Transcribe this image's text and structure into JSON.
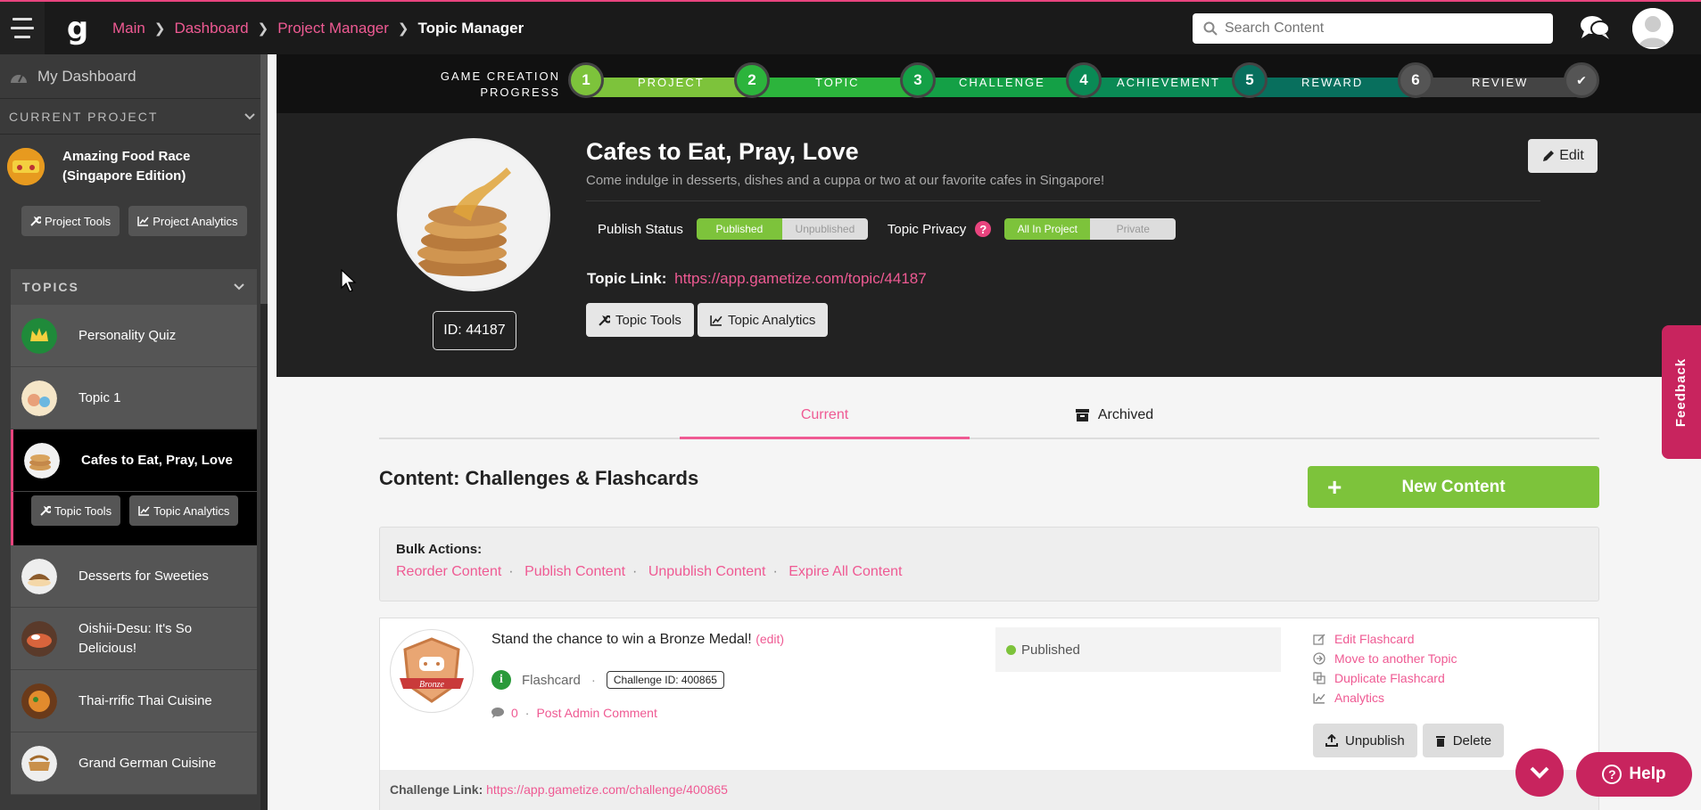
{
  "topbar": {
    "logo": "g",
    "breadcrumbs": [
      {
        "label": "Main"
      },
      {
        "label": "Dashboard"
      },
      {
        "label": "Project Manager"
      }
    ],
    "current": "Topic Manager",
    "search_placeholder": "Search Content"
  },
  "sidebar": {
    "my_dashboard": "My Dashboard",
    "current_project_header": "CURRENT PROJECT",
    "project_name": "Amazing Food Race (Singapore Edition)",
    "project_tools": "Project Tools",
    "project_analytics": "Project Analytics",
    "topics_header": "TOPICS",
    "topics": [
      {
        "label": "Personality Quiz"
      },
      {
        "label": "Topic 1"
      },
      {
        "label": "Cafes to Eat, Pray, Love"
      },
      {
        "label": "Desserts for Sweeties"
      },
      {
        "label": "Oishii-Desu: It's So Delicious!"
      },
      {
        "label": "Thai-rrific Thai Cuisine"
      },
      {
        "label": "Grand German Cuisine"
      }
    ],
    "topic_tools": "Topic Tools",
    "topic_analytics": "Topic Analytics"
  },
  "progress": {
    "label_line1": "GAME CREATION",
    "label_line2": "PROGRESS",
    "steps": [
      {
        "num": "1",
        "label": "PROJECT",
        "color": "#7dc33b"
      },
      {
        "num": "2",
        "label": "TOPIC",
        "color": "#2cb43c"
      },
      {
        "num": "3",
        "label": "CHALLENGE",
        "color": "#14a046"
      },
      {
        "num": "4",
        "label": "ACHIEVEMENT",
        "color": "#0a8a55"
      },
      {
        "num": "5",
        "label": "REWARD",
        "color": "#086f5d"
      },
      {
        "num": "6",
        "label": "REVIEW",
        "color": "#444444"
      }
    ],
    "done_glyph": "✔"
  },
  "topic": {
    "title": "Cafes to Eat, Pray, Love",
    "description": "Come indulge in desserts, dishes and a cuppa or two at our favorite cafes in Singapore!",
    "id_label": "ID: 44187",
    "edit": "Edit",
    "publish_status_label": "Publish Status",
    "published": "Published",
    "unpublished": "Unpublished",
    "privacy_label": "Topic Privacy",
    "all_in_project": "All In Project",
    "private": "Private",
    "link_label": "Topic Link:",
    "link": "https://app.gametize.com/topic/44187",
    "tools": "Topic Tools",
    "analytics": "Topic Analytics"
  },
  "tabs": {
    "current": "Current",
    "archived": "Archived"
  },
  "content": {
    "title": "Content: Challenges & Flashcards",
    "new_content": "New Content",
    "bulk_title": "Bulk Actions:",
    "bulk_actions": [
      {
        "label": "Reorder Content"
      },
      {
        "label": "Publish Content"
      },
      {
        "label": "Unpublish Content"
      },
      {
        "label": "Expire All Content"
      }
    ]
  },
  "card": {
    "badge_text": "Bronze",
    "title": "Stand the chance to win a Bronze Medal!",
    "edit": "(edit)",
    "type": "Flashcard",
    "challenge_id": "Challenge ID: 400865",
    "comment_count": "0",
    "post_comment": "Post Admin Comment",
    "status": "Published",
    "actions": [
      {
        "label": "Edit Flashcard"
      },
      {
        "label": "Move to another Topic"
      },
      {
        "label": "Duplicate Flashcard"
      },
      {
        "label": "Analytics"
      }
    ],
    "unpublish": "Unpublish",
    "delete": "Delete",
    "link_label": "Challenge Link:",
    "link": "https://app.gametize.com/challenge/400865"
  },
  "floating": {
    "feedback": "Feedback",
    "help": "Help"
  },
  "colors": {
    "accent": "#ef5a93",
    "green": "#7dc33b",
    "dark": "#222222"
  }
}
